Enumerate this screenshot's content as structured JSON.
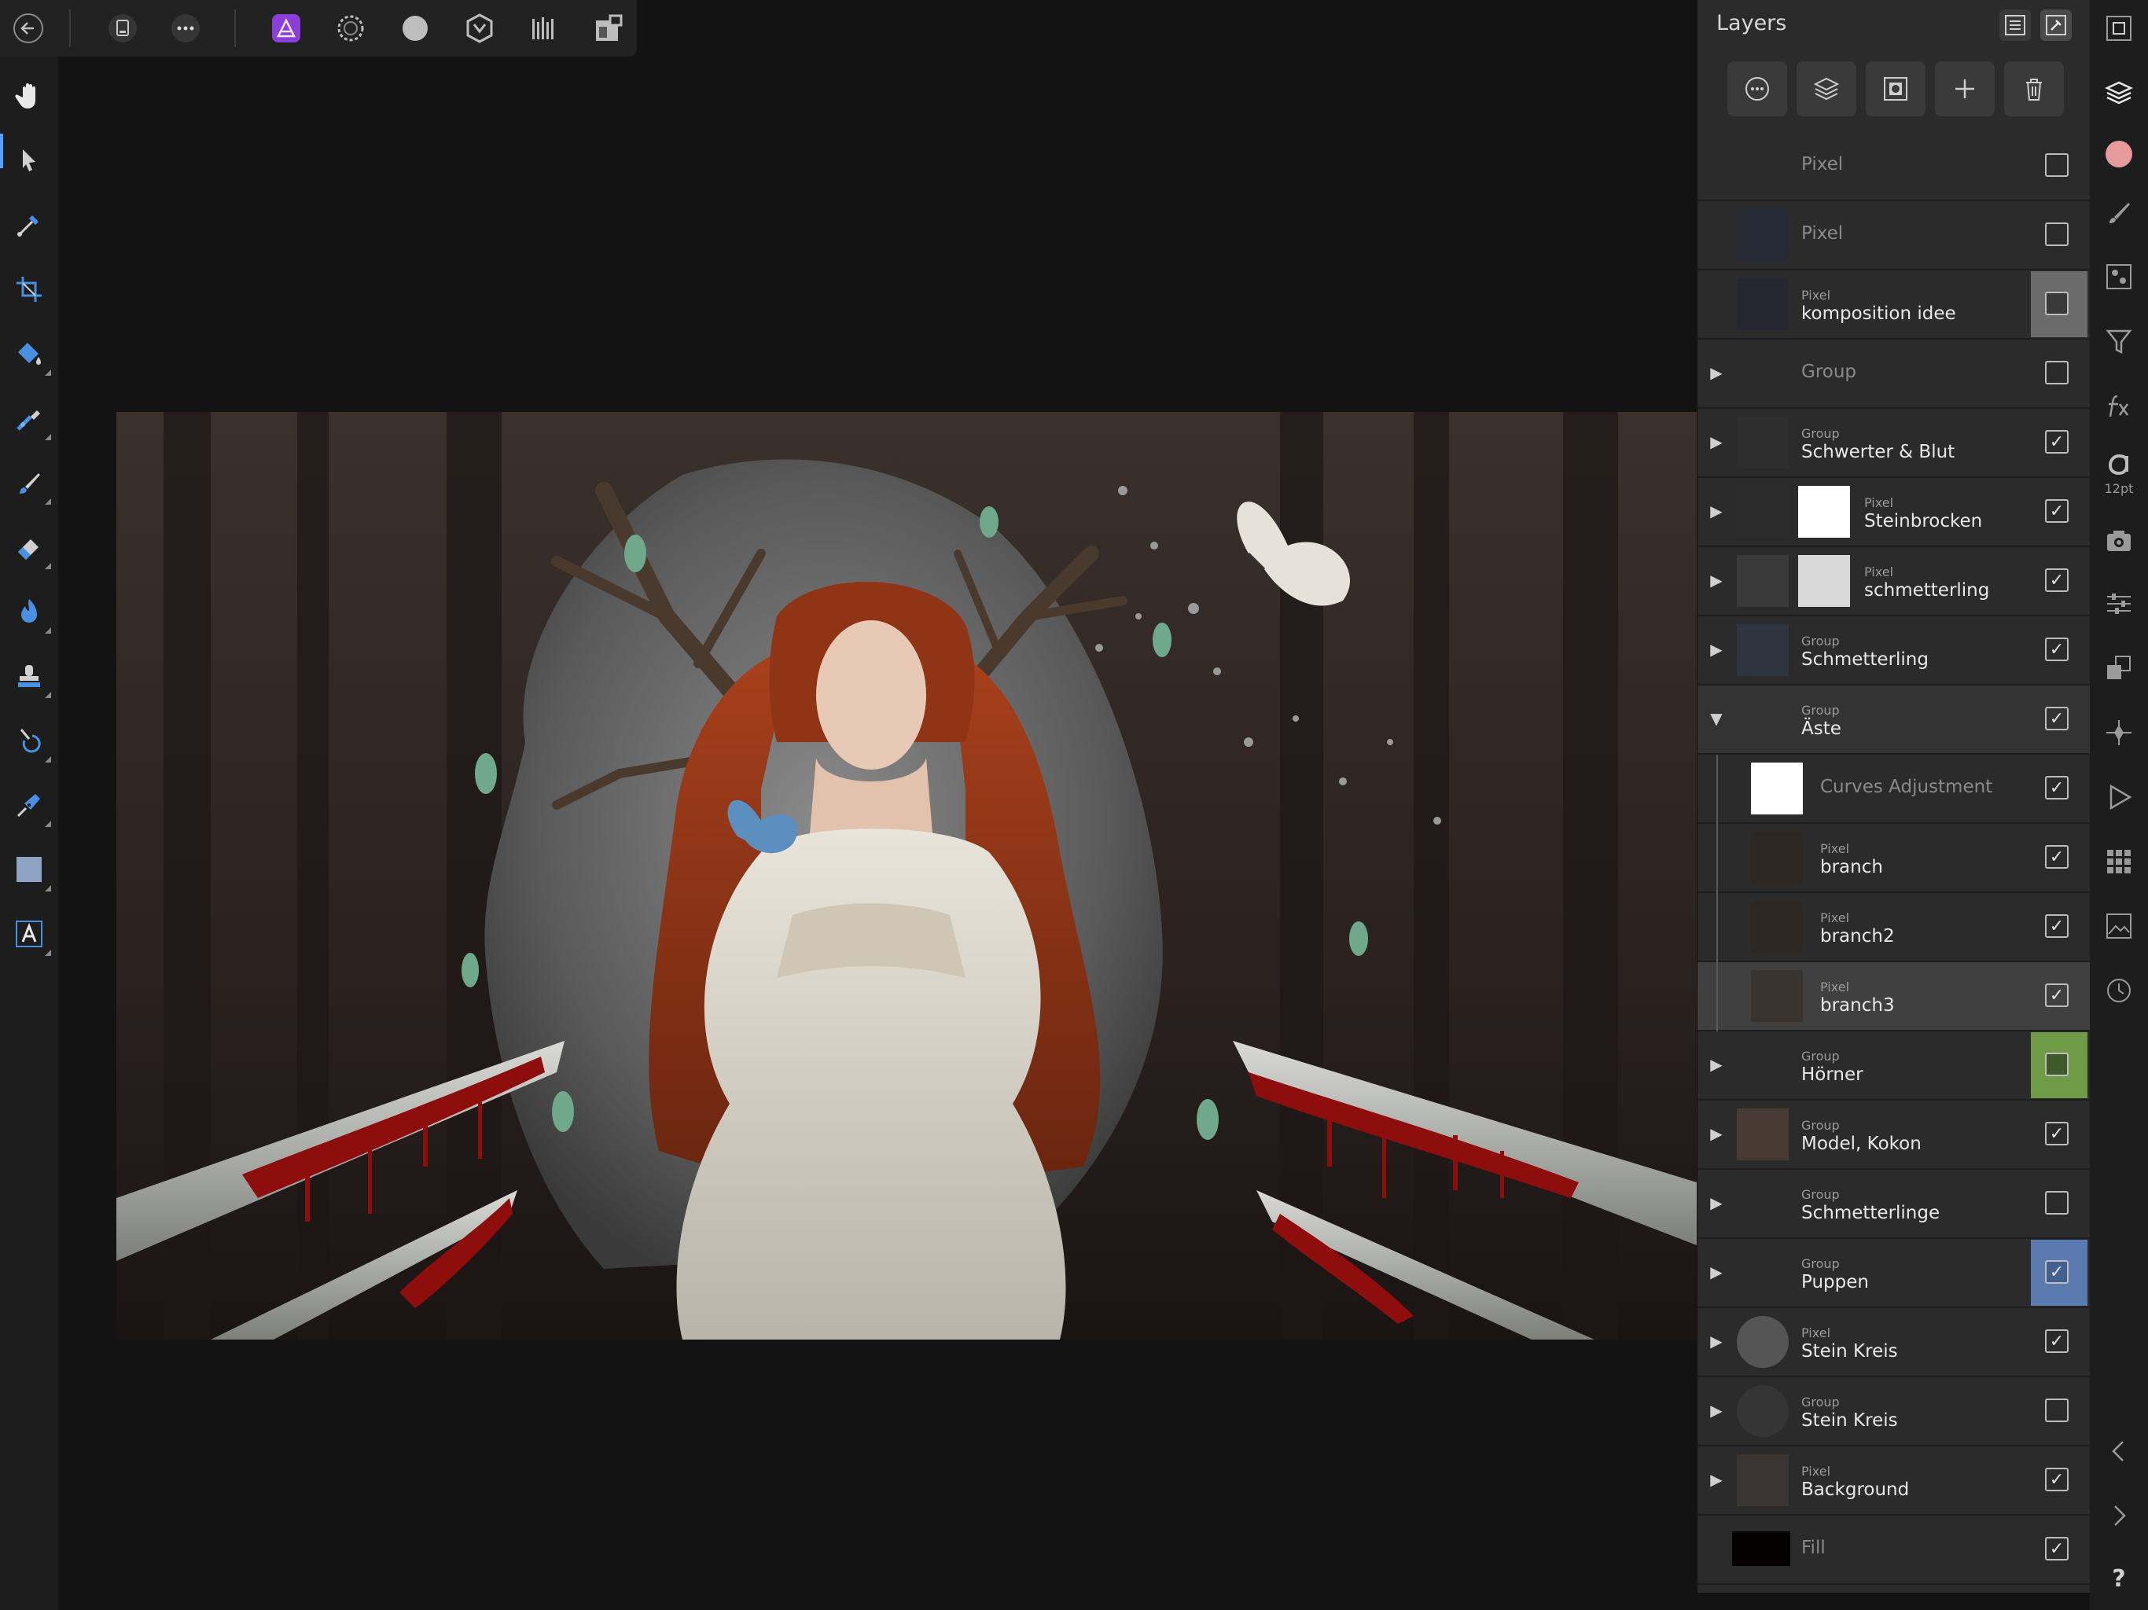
{
  "top_toolbar": {
    "back": "back-icon",
    "document": "document-icon",
    "more": "more-icon",
    "personas": [
      "photo-persona-icon",
      "liquify-persona-icon",
      "develop-persona-icon",
      "tone-mapping-persona-icon",
      "export-persona-icon"
    ],
    "view": "view-mode-icon"
  },
  "left_tools": [
    "view-tool",
    "move-tool",
    "color-picker-tool",
    "crop-tool",
    "flood-fill-tool",
    "paint-mixer-brush-tool",
    "paint-brush-tool",
    "erase-tool",
    "dodge-tool",
    "clone-tool",
    "blemish-removal-tool",
    "pen-tool",
    "rectangle-tool",
    "text-tool"
  ],
  "layers_panel": {
    "title": "Layers",
    "toolbar": [
      "blend-options-icon",
      "adjustments-icon",
      "mask-icon",
      "add-layer-icon",
      "delete-icon"
    ],
    "rows": [
      {
        "type": "",
        "name": "Pixel",
        "arrow": "",
        "visible": false,
        "dim": true
      },
      {
        "type": "",
        "name": "Pixel",
        "arrow": "",
        "visible": false,
        "dim": true
      },
      {
        "type": "Pixel",
        "name": "komposition idee",
        "arrow": "",
        "visible": false,
        "tag": "#6b6b6b"
      },
      {
        "type": "",
        "name": "Group",
        "arrow": "collapsed",
        "visible": false,
        "dim": true
      },
      {
        "type": "Group",
        "name": "Schwerter & Blut",
        "arrow": "collapsed",
        "visible": true
      },
      {
        "type": "Pixel",
        "name": "Steinbrocken",
        "arrow": "collapsed",
        "visible": true,
        "mask": true
      },
      {
        "type": "Pixel",
        "name": "schmetterling",
        "arrow": "collapsed",
        "visible": true,
        "mask": true
      },
      {
        "type": "Group",
        "name": "Schmetterling",
        "arrow": "collapsed",
        "visible": true
      },
      {
        "type": "Group",
        "name": "Äste",
        "arrow": "expanded",
        "visible": true
      },
      {
        "type": "",
        "name": "Curves Adjustment",
        "arrow": "",
        "visible": true,
        "child": true,
        "adjust": true
      },
      {
        "type": "Pixel",
        "name": "branch",
        "arrow": "",
        "visible": true,
        "child": true
      },
      {
        "type": "Pixel",
        "name": "branch2",
        "arrow": "",
        "visible": true,
        "child": true
      },
      {
        "type": "Pixel",
        "name": "branch3",
        "arrow": "",
        "visible": true,
        "child": true,
        "selected": true
      },
      {
        "type": "Group",
        "name": "Hörner",
        "arrow": "collapsed",
        "visible": false,
        "tag": "#6f9a48"
      },
      {
        "type": "Group",
        "name": "Model, Kokon",
        "arrow": "collapsed",
        "visible": true
      },
      {
        "type": "Group",
        "name": "Schmetterlinge",
        "arrow": "collapsed",
        "visible": false
      },
      {
        "type": "Group",
        "name": "Puppen",
        "arrow": "collapsed",
        "visible": true,
        "tag": "#5b7ab0"
      },
      {
        "type": "Pixel",
        "name": "Stein Kreis",
        "arrow": "collapsed",
        "visible": true
      },
      {
        "type": "Group",
        "name": "Stein Kreis",
        "arrow": "collapsed",
        "visible": false
      },
      {
        "type": "Pixel",
        "name": "Background",
        "arrow": "collapsed",
        "visible": true
      },
      {
        "type": "",
        "name": "Fill",
        "arrow": "",
        "visible": true,
        "fill": true
      }
    ]
  },
  "studio_strip": {
    "icons": [
      "navigator-icon",
      "layers-icon",
      "color-icon",
      "brushes-icon",
      "channels-icon",
      "filter-icon",
      "fx-icon",
      "character-icon",
      "camera-icon",
      "adjustments-sliders-icon",
      "transform-icon",
      "anchor-icon",
      "play-icon",
      "swatches-grid-icon",
      "image-icon",
      "history-icon",
      "previous-icon",
      "next-icon",
      "help-icon"
    ],
    "font_size_label": "12pt",
    "help_label": "?",
    "color_swatch": "#e79a9a"
  }
}
